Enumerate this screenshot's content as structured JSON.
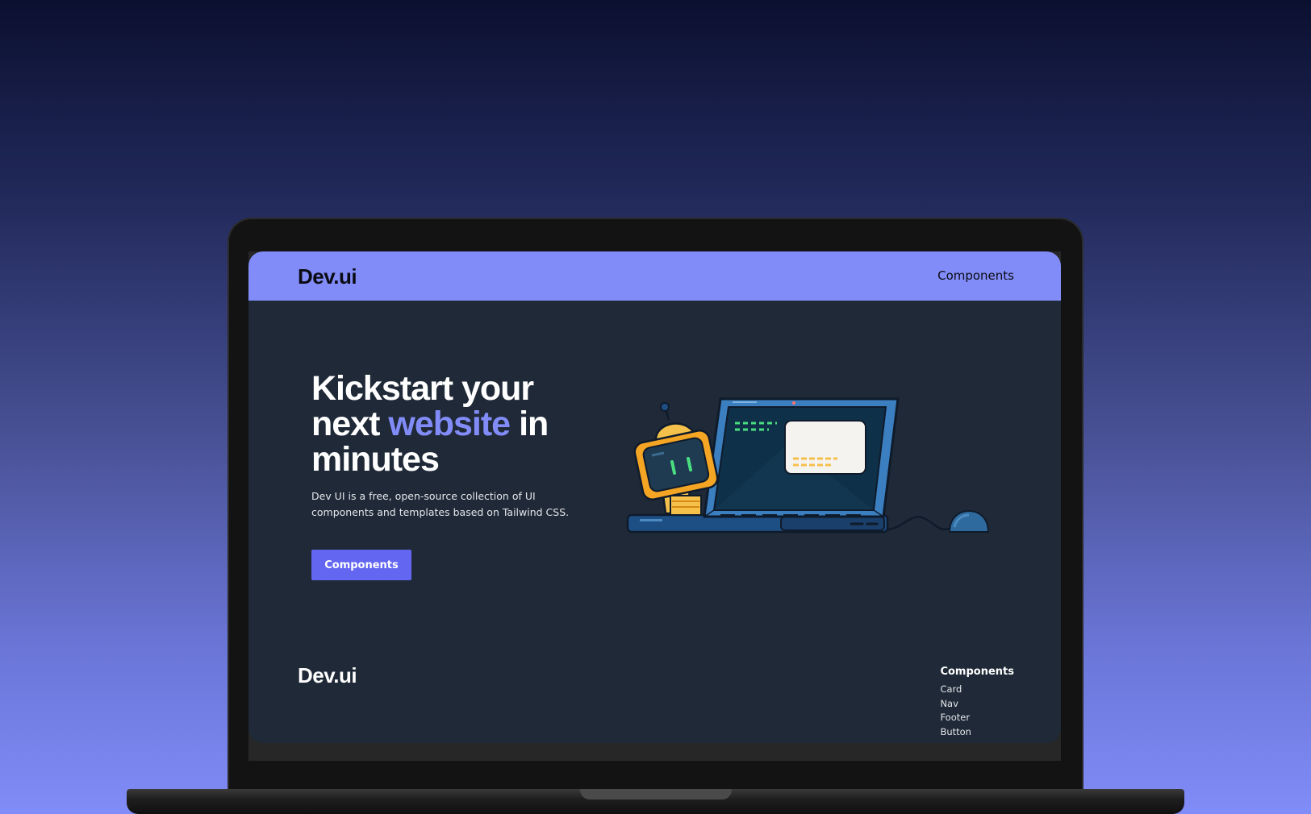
{
  "navbar": {
    "brand": "Dev.ui",
    "link": "Components"
  },
  "hero": {
    "title_line1": "Kickstart your",
    "title_next": "next",
    "title_accent": "website",
    "title_in": "in",
    "title_line3": "minutes",
    "description": "Dev UI is a free, open-source collection of UI components and templates based on Tailwind CSS.",
    "button_label": "Components",
    "illustration": {
      "laptop_icon": "laptop-icon",
      "robot_icon": "robot-icon",
      "mouse_icon": "mouse-icon"
    }
  },
  "footer": {
    "brand": "Dev.ui",
    "heading": "Components",
    "items": [
      "Card",
      "Nav",
      "Footer",
      "Button"
    ]
  },
  "colors": {
    "accent": "#818cf8",
    "button": "#6366f1",
    "page_bg": "#1f2937"
  }
}
